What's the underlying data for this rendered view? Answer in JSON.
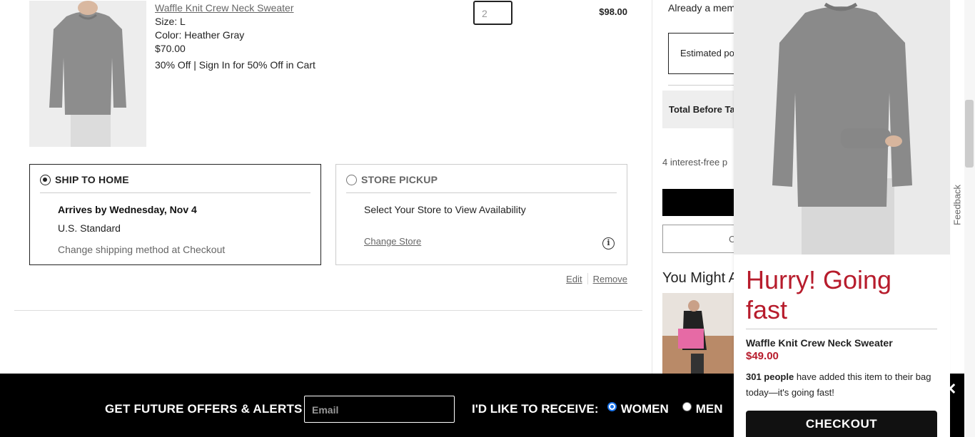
{
  "product": {
    "name": "Waffle Knit Crew Neck Sweater",
    "size": "Size: L",
    "color": "Color: Heather Gray",
    "price": "$70.00",
    "promo": "30% Off | Sign In for 50% Off in Cart",
    "quantity": "2",
    "line_total": "$98.00"
  },
  "shipping": {
    "home_label": "SHIP TO HOME",
    "arrives": "Arrives by Wednesday, Nov 4",
    "method": "U.S. Standard",
    "change_note": "Change shipping method at Checkout",
    "store_label": "STORE PICKUP",
    "store_note": "Select Your Store to View Availability",
    "change_store": "Change Store",
    "info_glyph": "i"
  },
  "actions": {
    "edit": "Edit",
    "remove": "Remove"
  },
  "summary": {
    "member_text": "Already a memb",
    "estimated": "Estimated po",
    "total_before": "Total Before Ta",
    "interest": "4 interest-free p",
    "outline_btn": "C",
    "you_might": "You Might A"
  },
  "footer": {
    "title": "GET FUTURE OFFERS & ALERTS",
    "email_placeholder": "Email",
    "receive": "I'D LIKE TO RECEIVE:",
    "women": "WOMEN",
    "men": "MEN"
  },
  "popup": {
    "headline": "Hurry! Going fast",
    "product_name": "Waffle Knit Crew Neck Sweater",
    "price": "$49.00",
    "count": "301 people",
    "text_rest": " have added this item to their bag today—it's going fast!",
    "checkout": "CHECKOUT",
    "close_glyph": "✕"
  },
  "feedback": "Feedback",
  "colors": {
    "accent_red": "#b71c2c",
    "black": "#000000",
    "radio_blue": "#1a73e8"
  }
}
